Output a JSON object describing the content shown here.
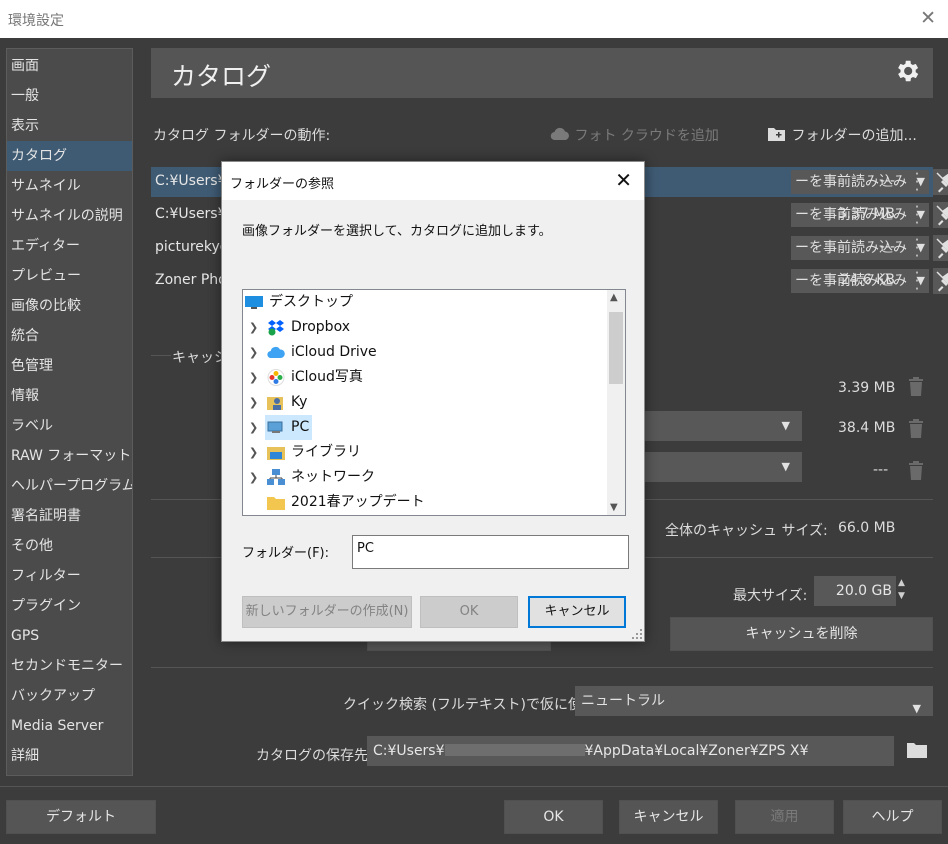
{
  "window": {
    "title": "環境設定"
  },
  "sidebar": {
    "items": [
      "画面",
      "一般",
      "表示",
      "カタログ",
      "サムネイル",
      "サムネイルの説明",
      "エディター",
      "プレビュー",
      "画像の比較",
      "統合",
      "色管理",
      "情報",
      "ラベル",
      "RAW フォーマット",
      "ヘルパープログラム",
      "署名証明書",
      "その他",
      "フィルター",
      "プラグイン",
      "GPS",
      "セカンドモニター",
      "バックアップ",
      "Media Server",
      "詳細"
    ],
    "selected": "カタログ"
  },
  "header": {
    "title": "カタログ"
  },
  "catalog": {
    "folders_label": "カタログ フォルダーの動作:",
    "photo_cloud": "フォト クラウドを追加",
    "add_folder": "フォルダーの追加...",
    "rows": [
      {
        "path": "C:¥Users¥",
        "mode": "ーを事前読み込み",
        "size": "---"
      },
      {
        "path": "C:¥Users¥",
        "mode": "ーを事前読み込み",
        "size": "3.37 MB"
      },
      {
        "path": "picturekyo",
        "mode": "ーを事前読み込み",
        "size": "---"
      },
      {
        "path": "Zoner Pho",
        "mode": "ーを事前読み込み",
        "size": "24.6 KB"
      }
    ]
  },
  "cache": {
    "section_label": "キャッシュ",
    "sizes": [
      "3.39 MB",
      "38.4 MB",
      "---"
    ],
    "total_label": "全体のキャッシュ サイズ:",
    "total_value": "66.0 MB",
    "max_label": "最大サイズ:",
    "max_value": "20.0 GB",
    "delete_btn": "キャッシュを削除"
  },
  "quick_search": {
    "label": "クイック検索 (フルテキスト)で仮に使用:",
    "value": "ニュートラル"
  },
  "save_location": {
    "label": "カタログの保存先:",
    "value_prefix": "C:¥Users¥",
    "value_suffix": "¥AppData¥Local¥Zoner¥ZPS X¥"
  },
  "footer": {
    "default": "デフォルト",
    "ok": "OK",
    "cancel": "キャンセル",
    "apply": "適用",
    "help": "ヘルプ"
  },
  "dialog": {
    "title": "フォルダーの参照",
    "description": "画像フォルダーを選択して、カタログに追加します。",
    "tree": [
      {
        "label": "デスクトップ",
        "icon": "desktop-icon",
        "expandable": false,
        "indent": 0
      },
      {
        "label": "Dropbox",
        "icon": "dropbox-icon",
        "expandable": true,
        "indent": 1
      },
      {
        "label": "iCloud Drive",
        "icon": "icloud-icon",
        "expandable": true,
        "indent": 1
      },
      {
        "label": "iCloud写真",
        "icon": "photos-icon",
        "expandable": true,
        "indent": 1
      },
      {
        "label": "Ky",
        "icon": "user-folder-icon",
        "expandable": true,
        "indent": 1
      },
      {
        "label": "PC",
        "icon": "pc-icon",
        "expandable": true,
        "indent": 1,
        "selected": true
      },
      {
        "label": "ライブラリ",
        "icon": "library-icon",
        "expandable": true,
        "indent": 1
      },
      {
        "label": "ネットワーク",
        "icon": "network-icon",
        "expandable": true,
        "indent": 1
      },
      {
        "label": "2021春アップデート",
        "icon": "folder-icon",
        "expandable": false,
        "indent": 1
      }
    ],
    "folder_label": "フォルダー(F):",
    "folder_value": "PC",
    "new_folder_btn": "新しいフォルダーの作成(N)",
    "ok_btn": "OK",
    "cancel_btn": "キャンセル"
  },
  "colors": {
    "accent": "#3f5b74",
    "bg": "#3c3c3c",
    "panel": "#4b4b4b"
  }
}
